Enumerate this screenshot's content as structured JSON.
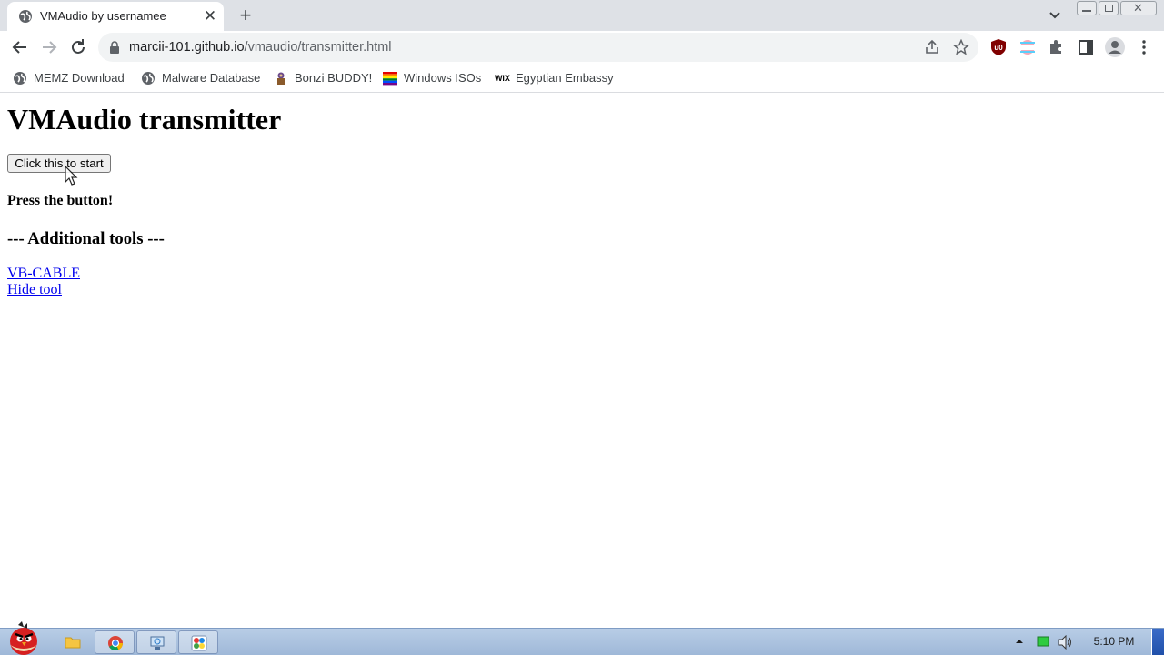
{
  "browser": {
    "tab": {
      "title": "VMAudio by usernamee"
    },
    "url": {
      "domain": "marcii-101.github.io",
      "path": "/vmaudio/transmitter.html"
    },
    "bookmarks": [
      {
        "label": "MEMZ Download",
        "icon": "globe-icon"
      },
      {
        "label": "Malware Database",
        "icon": "globe-icon"
      },
      {
        "label": "Bonzi BUDDY!",
        "icon": "bonzi-icon"
      },
      {
        "label": "Windows ISOs",
        "icon": "rainbow-flag-icon"
      },
      {
        "label": "Egyptian Embassy",
        "icon": "wix-icon"
      }
    ],
    "bookmark_wix_glyph": "WiX"
  },
  "page": {
    "title": "VMAudio transmitter",
    "start_button_label": "Click this to start",
    "status": "Press the button!",
    "tools_heading": "--- Additional tools ---",
    "links": [
      "VB-CABLE",
      "Hide tool"
    ],
    "link_color": "#0000ee"
  },
  "taskbar": {
    "items": [
      "angry-birds-start-icon",
      "folder-icon",
      "chrome-icon",
      "network-icon",
      "paint-icon"
    ],
    "clock": "5:10 PM"
  }
}
